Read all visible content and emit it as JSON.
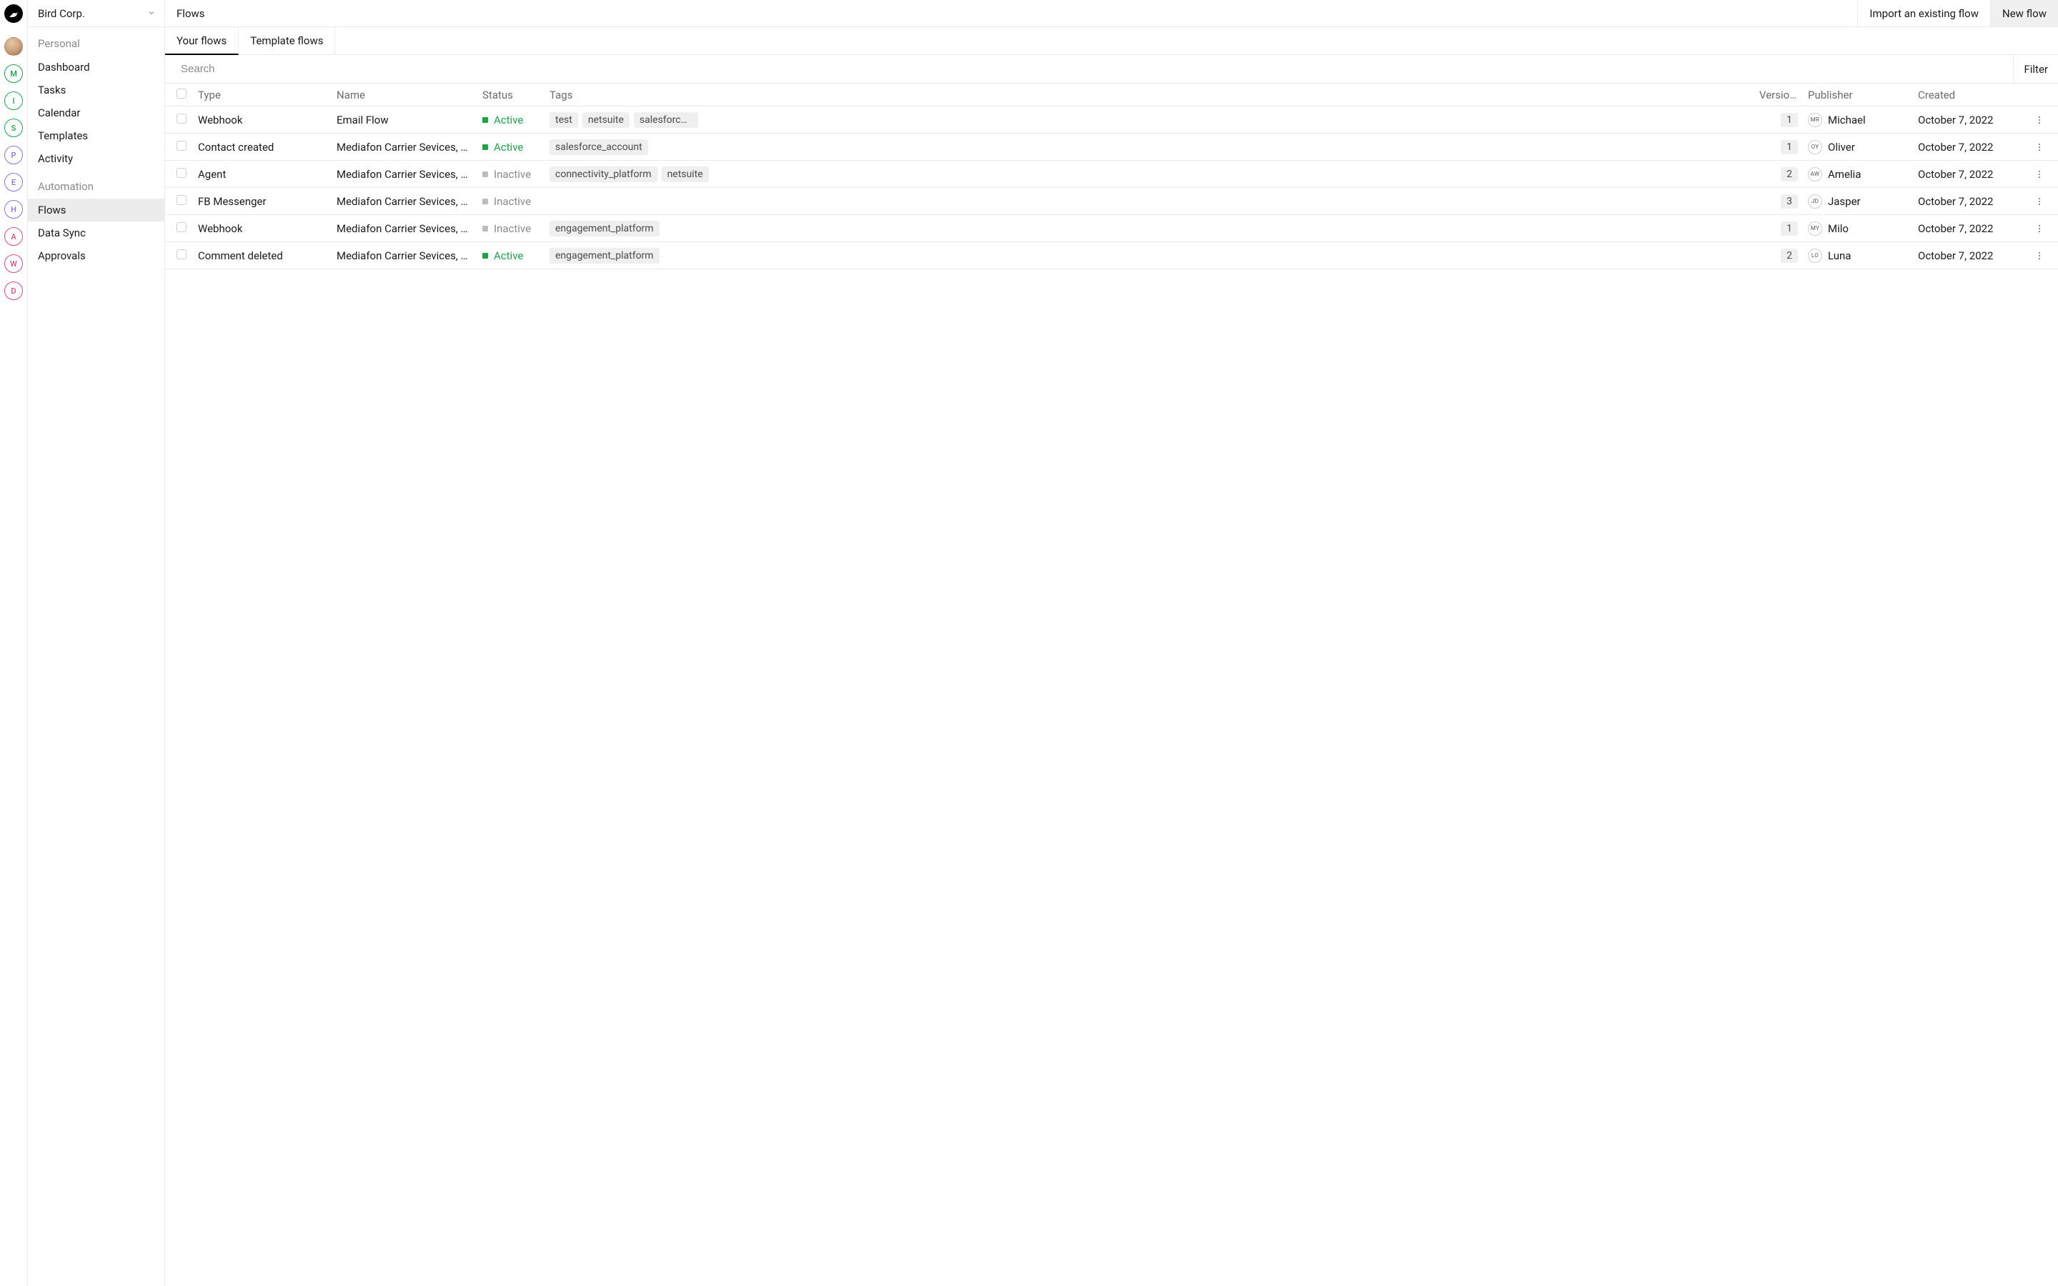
{
  "org_name": "Bird Corp.",
  "rail_workspaces": [
    {
      "initial": "M",
      "color": "#1fa34a"
    },
    {
      "initial": "I",
      "color": "#1fa34a"
    },
    {
      "initial": "S",
      "color": "#1fa34a"
    },
    {
      "initial": "P",
      "color": "#8a74d9"
    },
    {
      "initial": "E",
      "color": "#8a74d9"
    },
    {
      "initial": "H",
      "color": "#8a74d9"
    },
    {
      "initial": "A",
      "color": "#d64a86"
    },
    {
      "initial": "W",
      "color": "#d64a86"
    },
    {
      "initial": "D",
      "color": "#d64a86"
    }
  ],
  "sidebar": {
    "sections": [
      {
        "label": "Personal",
        "items": [
          {
            "label": "Dashboard"
          },
          {
            "label": "Tasks"
          },
          {
            "label": "Calendar"
          },
          {
            "label": "Templates"
          },
          {
            "label": "Activity"
          }
        ]
      },
      {
        "label": "Automation",
        "items": [
          {
            "label": "Flows",
            "active": true
          },
          {
            "label": "Data Sync"
          },
          {
            "label": "Approvals"
          }
        ]
      }
    ]
  },
  "page": {
    "title": "Flows",
    "import_button": "Import an existing flow",
    "new_button": "New flow"
  },
  "tabs": [
    {
      "label": "Your flows",
      "active": true
    },
    {
      "label": "Template flows"
    }
  ],
  "search": {
    "placeholder": "Search"
  },
  "filter_label": "Filter",
  "columns": {
    "type": "Type",
    "name": "Name",
    "status": "Status",
    "tags": "Tags",
    "versions": "Versions",
    "publisher": "Publisher",
    "created": "Created"
  },
  "status_labels": {
    "active": "Active",
    "inactive": "Inactive"
  },
  "rows": [
    {
      "type": "Webhook",
      "name": "Email Flow",
      "status": "active",
      "tags": [
        "test",
        "netsuite",
        "salesforce_account"
      ],
      "versions": "1",
      "publisher_initials": "MR",
      "publisher": "Michael",
      "created": "October 7, 2022"
    },
    {
      "type": "Contact created",
      "name": "Mediafon Carrier Sevices, U...",
      "status": "active",
      "tags": [
        "salesforce_account"
      ],
      "versions": "1",
      "publisher_initials": "OY",
      "publisher": "Oliver",
      "created": "October 7, 2022"
    },
    {
      "type": "Agent",
      "name": "Mediafon Carrier Sevices, U...",
      "status": "inactive",
      "tags": [
        "connectivity_platform",
        "netsuite"
      ],
      "versions": "2",
      "publisher_initials": "AW",
      "publisher": "Amelia",
      "created": "October 7, 2022"
    },
    {
      "type": "FB Messenger",
      "name": "Mediafon Carrier Sevices, U...",
      "status": "inactive",
      "tags": [],
      "versions": "3",
      "publisher_initials": "JD",
      "publisher": "Jasper",
      "created": "October 7, 2022"
    },
    {
      "type": "Webhook",
      "name": "Mediafon Carrier Sevices, U...",
      "status": "inactive",
      "tags": [
        "engagement_platform"
      ],
      "versions": "1",
      "publisher_initials": "MY",
      "publisher": "Milo",
      "created": "October 7, 2022"
    },
    {
      "type": "Comment deleted",
      "name": "Mediafon Carrier Sevices, U...",
      "status": "active",
      "tags": [
        "engagement_platform"
      ],
      "versions": "2",
      "publisher_initials": "LO",
      "publisher": "Luna",
      "created": "October 7, 2022"
    }
  ]
}
